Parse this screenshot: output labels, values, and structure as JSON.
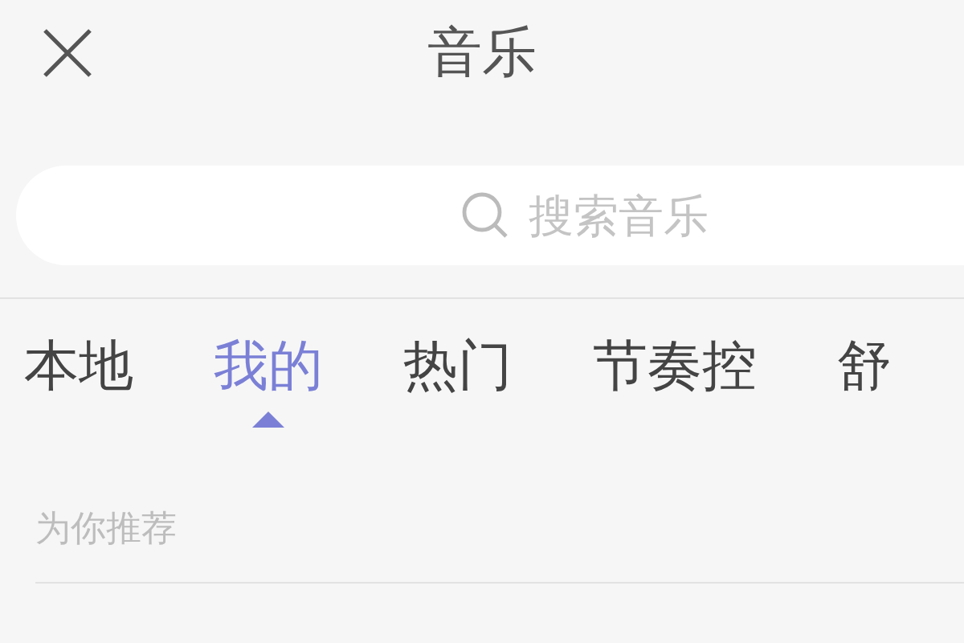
{
  "header": {
    "title": "音乐"
  },
  "search": {
    "placeholder": "搜索音乐"
  },
  "tabs": [
    {
      "label": "本地",
      "selected": false
    },
    {
      "label": "我的",
      "selected": true
    },
    {
      "label": "热门",
      "selected": false
    },
    {
      "label": "节奏控",
      "selected": false
    },
    {
      "label": "舒",
      "selected": false
    }
  ],
  "section": {
    "title": "为你推荐"
  }
}
